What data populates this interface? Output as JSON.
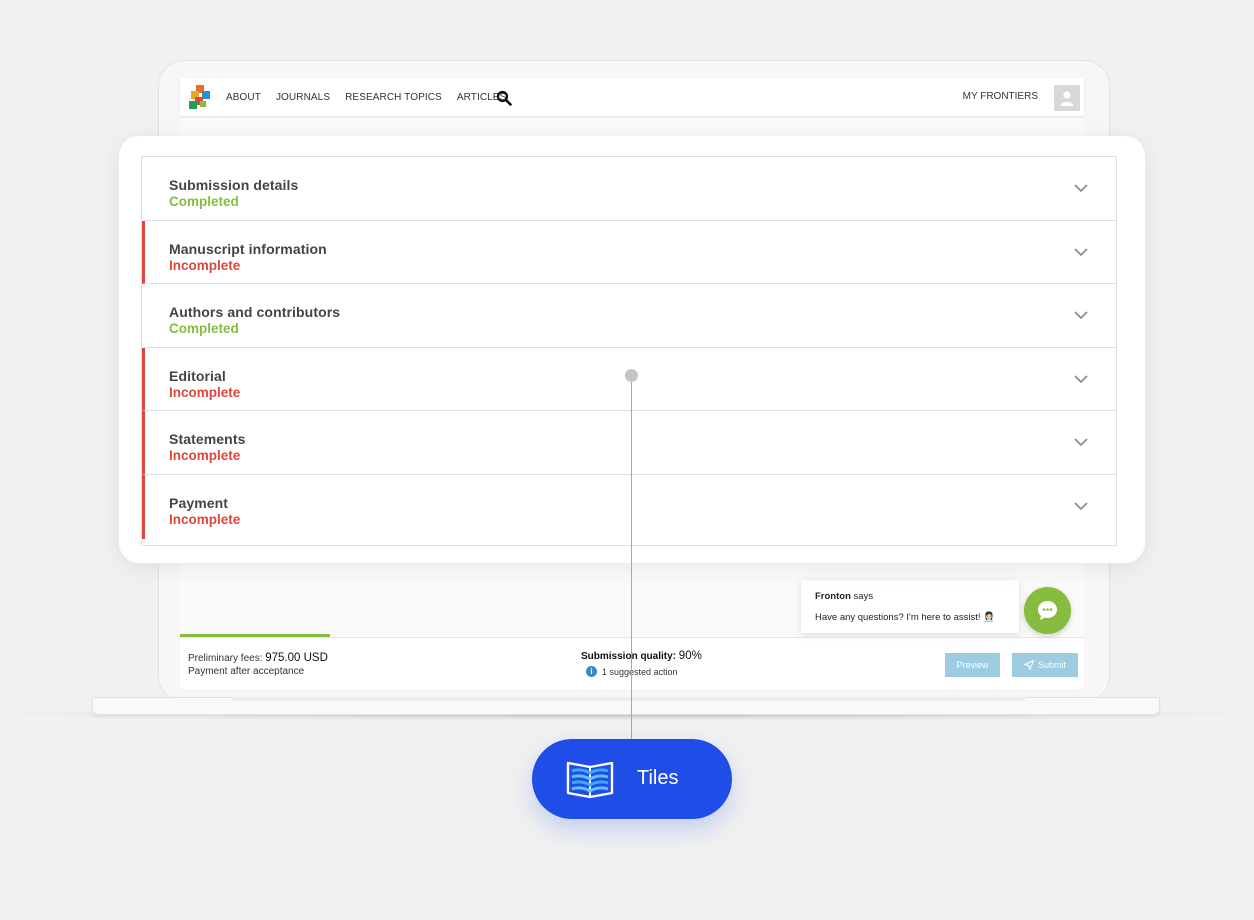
{
  "nav": {
    "links": [
      "ABOUT",
      "JOURNALS",
      "RESEARCH TOPICS",
      "ARTICLES"
    ],
    "my_frontiers": "MY FRONTIERS",
    "icons": {
      "logo": "frontiers-logo",
      "search": "search-icon",
      "avatar": "user-avatar-icon"
    }
  },
  "accordion": {
    "sections": [
      {
        "title": "Submission details",
        "status": "Completed"
      },
      {
        "title": "Manuscript information",
        "status": "Incomplete"
      },
      {
        "title": "Authors and contributors",
        "status": "Completed"
      },
      {
        "title": "Editorial",
        "status": "Incomplete"
      },
      {
        "title": "Statements",
        "status": "Incomplete"
      },
      {
        "title": "Payment",
        "status": "Incomplete"
      }
    ],
    "colors": {
      "completed": "#86bc40",
      "incomplete": "#d9473f"
    }
  },
  "chat": {
    "name": "Fronton",
    "says": "says",
    "message": "Have any questions? I'm here to assist! 👩🏻‍💼"
  },
  "footer": {
    "fees_label": "Preliminary fees:",
    "fees_amount": "975.00 USD",
    "fees_sub": "Payment after acceptance",
    "quality_label": "Submission quality:",
    "quality_value": "90%",
    "suggested": "1 suggested action",
    "preview_label": "Preview",
    "submit_label": "Submit",
    "progress_fraction": 0.166
  },
  "tiles": {
    "label": "Tiles",
    "icon": "open-book-icon",
    "color": "#1f4de8"
  }
}
